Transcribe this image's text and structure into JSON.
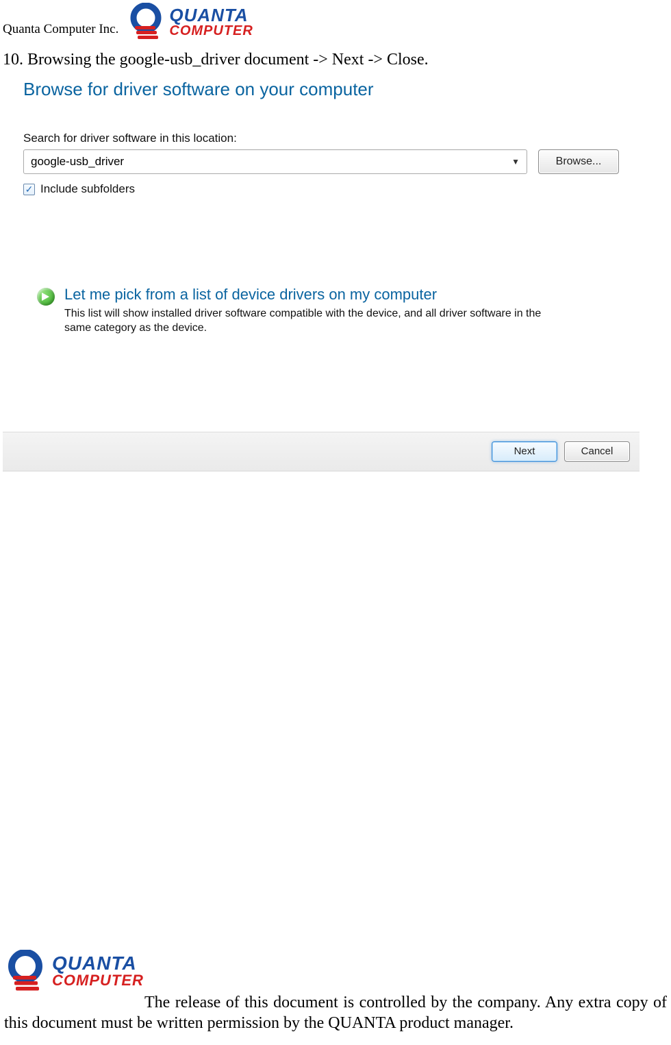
{
  "header": {
    "company": "Quanta Computer Inc.",
    "logo_top": "QUANTA",
    "logo_bottom": "COMPUTER"
  },
  "instruction": "10. Browsing the google-usb_driver document -> Next -> Close.",
  "dialog": {
    "title": "Browse for driver software on your computer",
    "search_label": "Search for driver software in this location:",
    "path_value": "google-usb_driver",
    "browse_label": "Browse...",
    "include_label": "Include subfolders",
    "include_checked": true,
    "pick_title": "Let me pick from a list of device drivers on my computer",
    "pick_desc": "This list will show installed driver software compatible with the device, and all driver software in the same category as the device.",
    "next_label": "Next",
    "cancel_label": "Cancel"
  },
  "footer": {
    "logo_top": "QUANTA",
    "logo_bottom": "COMPUTER",
    "line1": "The release of this document is controlled by the company. Any extra",
    "line2": "copy of this document must be written permission by the QUANTA product manager."
  }
}
